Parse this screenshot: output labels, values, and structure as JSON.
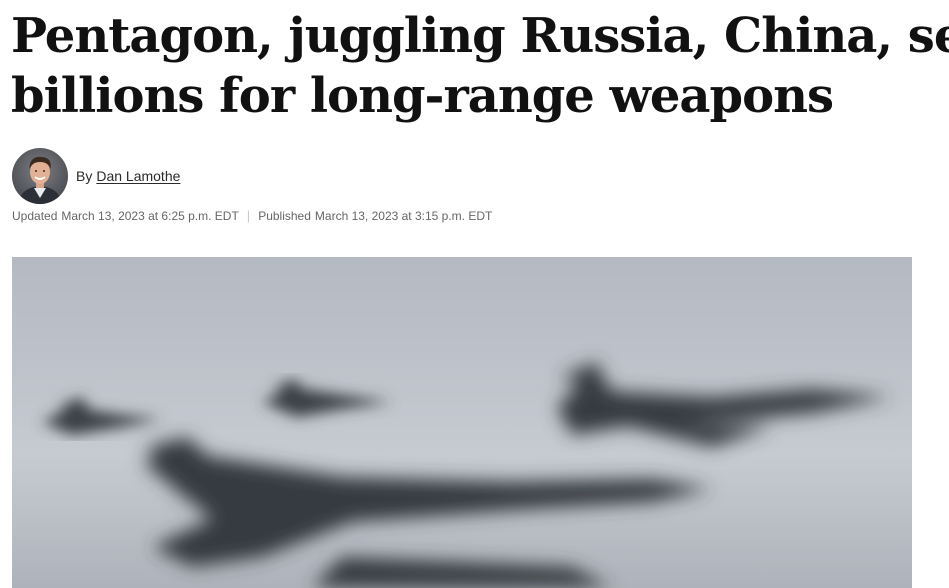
{
  "article": {
    "headline_line1": "Pentagon, juggling Russia, China, seeks",
    "headline_line2": "billions for long-range weapons",
    "byline_prefix": "By",
    "author_name": "Dan Lamothe",
    "updated_label": "Updated",
    "updated_time": "March 13, 2023 at 6:25 p.m. EDT",
    "separator": "|",
    "published_label": "Published",
    "published_time": "March 13, 2023 at 3:15 p.m. EDT"
  },
  "colors": {
    "headline": "#111111",
    "meta_text": "#666666",
    "sky": "#bcc1c8",
    "aircraft": "#3a3f46"
  },
  "icons": {
    "avatar": "author-headshot",
    "photo": "military-aircraft-formation-photo"
  }
}
